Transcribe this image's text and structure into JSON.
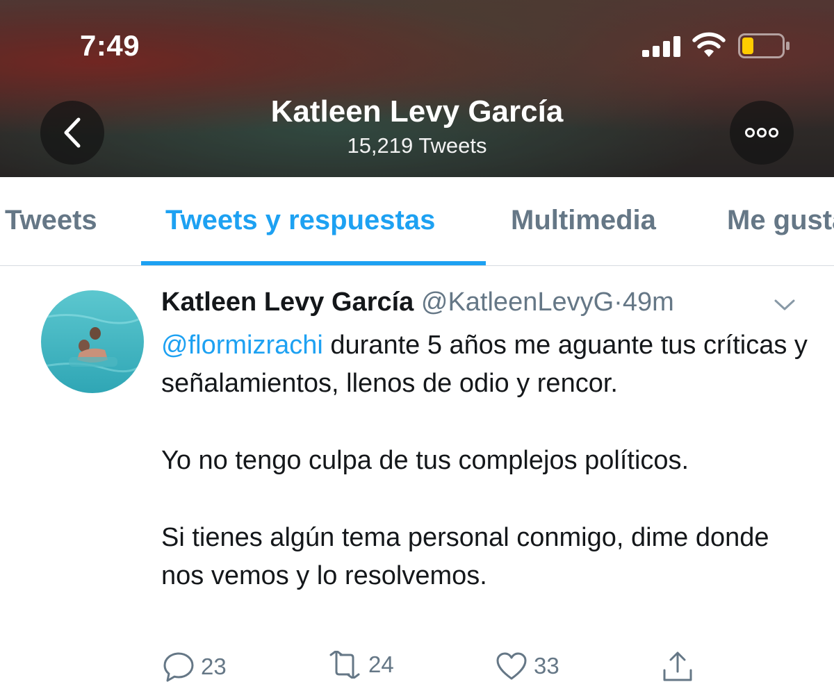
{
  "status_bar": {
    "time": "7:49",
    "signal_icon": "cellular-signal-icon",
    "wifi_icon": "wifi-icon",
    "battery_icon": "battery-low-icon",
    "battery_color": "#ffcc00"
  },
  "header": {
    "title": "Katleen Levy García",
    "subtitle": "15,219 Tweets",
    "back_icon": "chevron-left-icon",
    "more_icon": "more-horizontal-icon"
  },
  "tabs": [
    {
      "label": "Tweets",
      "active": false
    },
    {
      "label": "Tweets y respuestas",
      "active": true
    },
    {
      "label": "Multimedia",
      "active": false
    },
    {
      "label": "Me gusta",
      "active": false
    }
  ],
  "tweet": {
    "author_name": "Katleen Levy García",
    "handle": "@KatleenLevyG",
    "separator": "·",
    "time": "49m",
    "mention": "@flormizrachi",
    "line1_rest": " durante 5 años me aguante tus críticas y señalamientos, llenos de odio y rencor.",
    "paragraph2": "Yo no tengo culpa de tus complejos políticos.",
    "paragraph3": "Si tienes algún tema personal conmigo, dime donde nos vemos y lo resolvemos.",
    "actions": {
      "reply_count": "23",
      "retweet_count": "24",
      "like_count": "33"
    }
  },
  "colors": {
    "accent": "#1da1f2",
    "muted": "#657786",
    "text": "#14171a"
  }
}
